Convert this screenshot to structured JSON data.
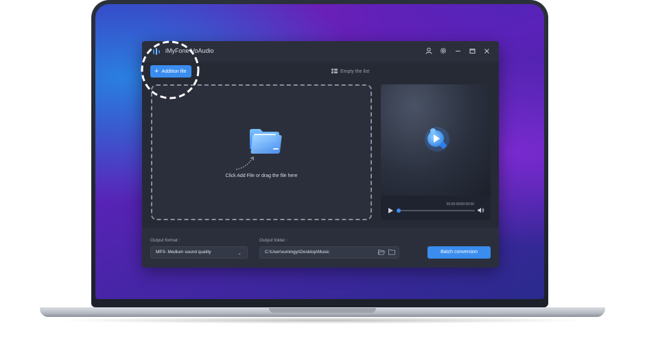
{
  "app": {
    "title": "iMyFone VoAudio",
    "add_file_label": "Addition file",
    "empty_list_label": "Empty the list",
    "drop_hint": "Click Add File or drag the file here"
  },
  "player": {
    "time": "00:00:00/00:00:00",
    "progress": 0
  },
  "bottom": {
    "output_format_label": "Output format :",
    "output_format_value": "MP3- Medium sound quality",
    "output_folder_label": "Output folder :",
    "output_folder_value": "C:\\User\\xumingyi\\Desktop\\Music",
    "batch_label": "Batch conversion"
  },
  "colors": {
    "accent": "#3a8dee",
    "window_bg": "#262a35",
    "panel_bg": "#2b2f3b"
  },
  "icons": [
    "logo-icon",
    "user-icon",
    "gear-icon",
    "minimize-icon",
    "maximize-icon",
    "close-icon",
    "plus-icon",
    "grid-icon",
    "folder-icon",
    "arrow-icon",
    "media-play-icon",
    "play-icon",
    "volume-icon",
    "chevron-down-icon",
    "open-folder-icon",
    "folder-browse-icon"
  ]
}
